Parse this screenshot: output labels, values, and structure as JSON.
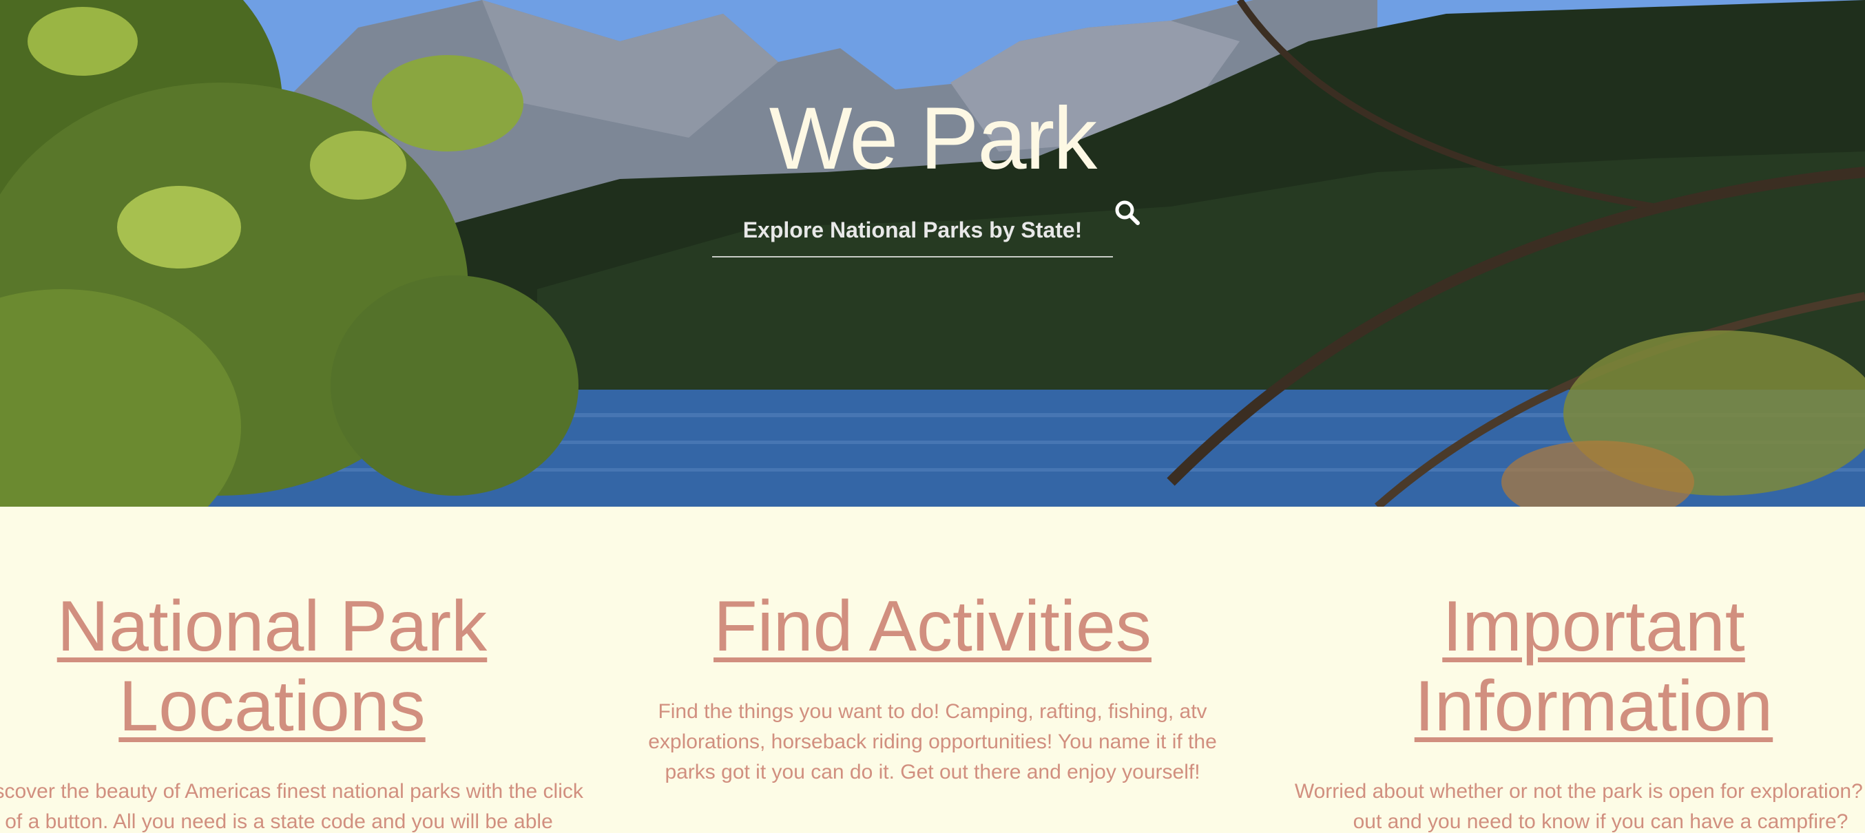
{
  "hero": {
    "title": "We Park",
    "search_placeholder": "Explore National Parks by State!",
    "search_icon": "search-icon"
  },
  "columns": [
    {
      "title_line1": "National Park",
      "title_line2": "Locations",
      "text": "Discover the beauty of Americas finest national parks with the click of a button. All you need is a state code and you will be able"
    },
    {
      "title_line1": "Find Activities",
      "title_line2": "",
      "text": "Find the things you want to do! Camping, rafting, fishing, atv explorations, horseback riding opportunities! You name it if the parks got it you can do it. Get out there and enjoy yourself!"
    },
    {
      "title_line1": "Important",
      "title_line2": "Information",
      "text": "Worried about whether or not the park is open for exploration? cold out and you need to know if you can have a campfire?"
    }
  ],
  "colors": {
    "background": "#fdfce6",
    "accent": "#d18f7f",
    "hero_title": "#fdf8e4"
  }
}
